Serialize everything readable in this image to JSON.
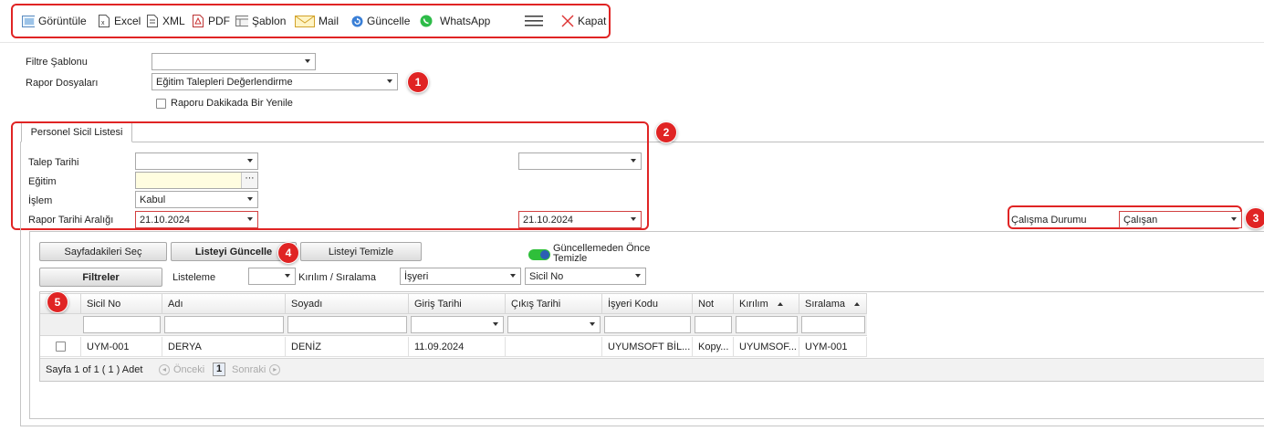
{
  "toolbar": {
    "items": [
      {
        "label": "Görüntüle",
        "icon": "preview-icon"
      },
      {
        "label": "Excel",
        "icon": "excel-icon"
      },
      {
        "label": "XML",
        "icon": "xml-icon"
      },
      {
        "label": "PDF",
        "icon": "pdf-icon"
      },
      {
        "label": "Şablon",
        "icon": "template-icon"
      },
      {
        "label": "Mail",
        "icon": "mail-icon"
      },
      {
        "label": "Güncelle",
        "icon": "refresh-icon"
      },
      {
        "label": "WhatsApp",
        "icon": "whatsapp-icon"
      },
      {
        "label": "",
        "icon": "menu-icon"
      },
      {
        "label": "Kapat",
        "icon": "close-icon"
      }
    ]
  },
  "top_form": {
    "filter_template_label": "Filtre Şablonu",
    "filter_template_value": "",
    "report_files_label": "Rapor Dosyaları",
    "report_files_value": "Eğitim Talepleri Değerlendirme",
    "refresh_minute_label": "Raporu Dakikada Bir Yenile"
  },
  "tab": {
    "label": "Personel Sicil Listesi"
  },
  "params": {
    "request_date_label": "Talep Tarihi",
    "request_date_value": "",
    "request_date_value2": "",
    "training_label": "Eğitim",
    "training_value": "",
    "action_label": "İşlem",
    "action_value": "Kabul",
    "report_range_label": "Rapor Tarihi Aralığı",
    "report_range_start": "21.10.2024",
    "report_range_end": "21.10.2024",
    "work_status_label": "Çalışma Durumu",
    "work_status_value": "Çalışan"
  },
  "actions": {
    "select_page_label": "Sayfadakileri Seç",
    "update_list_label": "Listeyi Güncelle",
    "clear_list_label": "Listeyi Temizle",
    "clear_before_update_label_1": "Güncellemeden Önce",
    "clear_before_update_label_2": "Temizle",
    "filters_label": "Filtreler",
    "listing_label": "Listeleme",
    "listing_value": "",
    "breakdown_label": "Kırılım / Sıralama",
    "breakdown_value": "İşyeri",
    "sort_value": "Sicil No"
  },
  "grid": {
    "columns": [
      "Sicil No",
      "Adı",
      "Soyadı",
      "Giriş Tarihi",
      "Çıkış Tarihi",
      "İşyeri Kodu",
      "Not",
      "Kırılım",
      "Sıralama"
    ],
    "rows": [
      [
        "UYM-001",
        "DERYA",
        "DENİZ",
        "11.09.2024",
        "",
        "UYUMSOFT BİL...",
        "Kopy...",
        "UYUMSOF...",
        "UYM-001"
      ]
    ]
  },
  "pager": {
    "summary": "Sayfa 1 of 1 ( 1 ) Adet",
    "prev_label": "Önceki",
    "current_page": "1",
    "next_label": "Sonraki"
  },
  "badges": [
    "1",
    "2",
    "3",
    "4",
    "5"
  ],
  "colors": {
    "highlight": "#e02424",
    "toggle_on": "#2fbf3a",
    "training_bg": "#fffde0"
  }
}
